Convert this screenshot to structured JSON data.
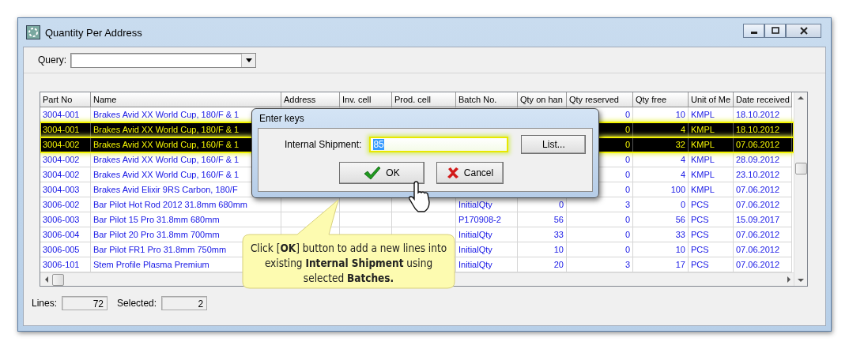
{
  "window": {
    "title": "Quantity Per Address"
  },
  "query": {
    "label": "Query:"
  },
  "table": {
    "columns": [
      {
        "label": "Part No",
        "kind": "text"
      },
      {
        "label": "Name",
        "kind": "text"
      },
      {
        "label": "Address",
        "kind": "text"
      },
      {
        "label": "Inv. cell",
        "kind": "text"
      },
      {
        "label": "Prod. cell",
        "kind": "text"
      },
      {
        "label": "Batch No.",
        "kind": "text"
      },
      {
        "label": "Qty on han",
        "kind": "number"
      },
      {
        "label": "Qty reserved",
        "kind": "number"
      },
      {
        "label": "Qty free",
        "kind": "number"
      },
      {
        "label": "Unit of Me",
        "kind": "text"
      },
      {
        "label": "Date received",
        "kind": "text"
      }
    ],
    "rows": [
      {
        "selected": false,
        "cells": [
          "3004-001",
          "Brakes Avid XX World Cup, 180/F & 1",
          null,
          null,
          null,
          null,
          null,
          "0",
          "10",
          "KMPL",
          "18.10.2012"
        ]
      },
      {
        "selected": true,
        "cells": [
          "3004-001",
          "Brakes Avid XX World Cup, 180/F & 1",
          null,
          null,
          null,
          null,
          null,
          "0",
          "4",
          "KMPL",
          "18.10.2012"
        ]
      },
      {
        "selected": true,
        "cells": [
          "3004-002",
          "Brakes Avid XX World Cup, 160/F & 1",
          null,
          null,
          null,
          null,
          null,
          "0",
          "32",
          "KMPL",
          "07.06.2012"
        ]
      },
      {
        "selected": false,
        "cells": [
          "3004-002",
          "Brakes Avid XX World Cup, 160/F & 1",
          null,
          null,
          null,
          null,
          null,
          "0",
          "4",
          "KMPL",
          "28.09.2012"
        ]
      },
      {
        "selected": false,
        "cells": [
          "3004-002",
          "Brakes Avid XX World Cup, 160/F & 1",
          null,
          null,
          null,
          null,
          null,
          "0",
          "4",
          "KMPL",
          "23.10.2012"
        ]
      },
      {
        "selected": false,
        "cells": [
          "3004-003",
          "Brakes Avid Elixir 9RS Carbon, 180/F",
          null,
          null,
          null,
          null,
          null,
          "0",
          "100",
          "KMPL",
          "07.06.2012"
        ]
      },
      {
        "selected": false,
        "cells": [
          "3006-002",
          "Bar Pilot Hot Rod 2012 31.8mm 680mm",
          null,
          null,
          null,
          "InitialQty",
          "0",
          "3",
          "0",
          "PCS",
          "07.06.2012"
        ]
      },
      {
        "selected": false,
        "cells": [
          "3006-003",
          "Bar Pilot 15 Pro 31.8mm 680mm",
          null,
          null,
          null,
          "P170908-2",
          "56",
          "0",
          "56",
          "PCS",
          "15.09.2017"
        ]
      },
      {
        "selected": false,
        "cells": [
          "3006-004",
          "Bar Pilot 20 Pro 31.8mm 700mm",
          null,
          null,
          null,
          "InitialQty",
          "33",
          "0",
          "33",
          "PCS",
          "07.06.2012"
        ]
      },
      {
        "selected": false,
        "cells": [
          "3006-005",
          "Bar Pilot FR1 Pro 31.8mm 750mm",
          null,
          null,
          null,
          "InitialQty",
          "10",
          "0",
          "10",
          "PCS",
          "07.06.2012"
        ]
      },
      {
        "selected": false,
        "cells": [
          "3006-101",
          "Stem Profile Plasma Premium",
          null,
          null,
          null,
          "InitialQty",
          "20",
          "3",
          "17",
          "PCS",
          "07.06.2012"
        ]
      }
    ]
  },
  "dialog": {
    "title": "Enter keys",
    "field_label": "Internal Shipment:",
    "value": "85",
    "value_selected": true,
    "highlighted": true,
    "list_button": "List...",
    "buttons": [
      {
        "label": "OK",
        "kind": "ok"
      },
      {
        "label": "Cancel",
        "kind": "cancel"
      }
    ]
  },
  "callout": {
    "text": "Click [**OK**] button to add a new lines into existing **Internal Shipment** using selected **Batches.**"
  },
  "status_bar": {
    "items": [
      {
        "label": "Lines:",
        "value": "72"
      },
      {
        "label": "Selected:",
        "value": "2"
      }
    ]
  }
}
